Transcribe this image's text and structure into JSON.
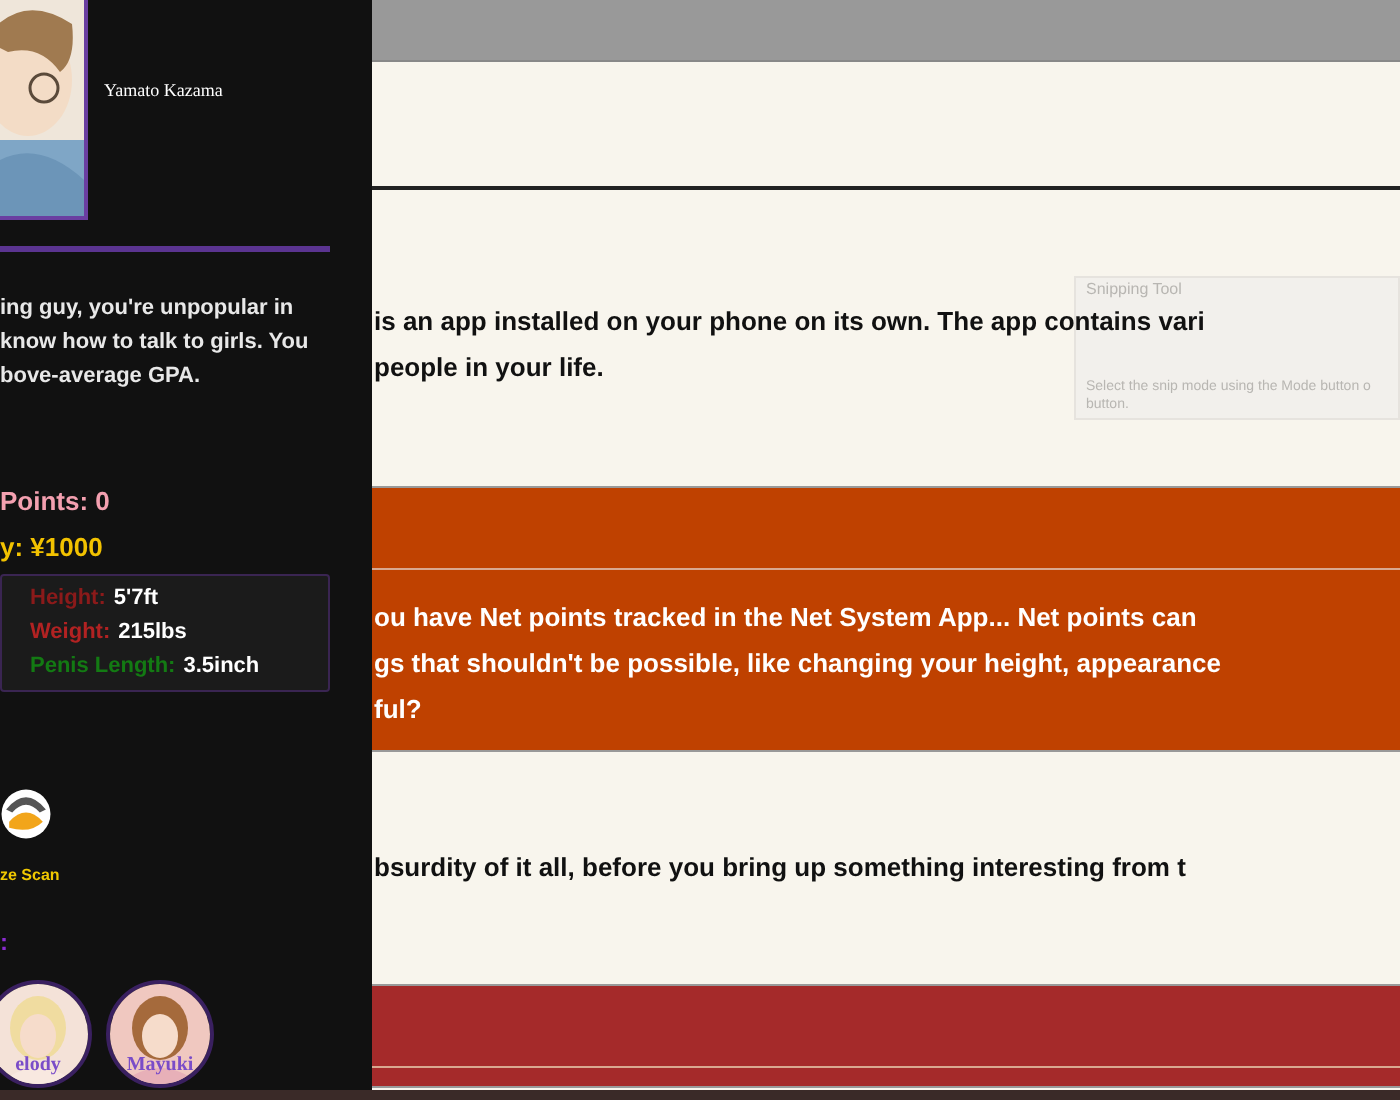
{
  "profile": {
    "name": "Yamato Kazama",
    "bio_lines": [
      "ing guy, you're unpopular in",
      "know how to talk to girls. You",
      "bove-average GPA."
    ],
    "points": "Points: 0",
    "money": "y: ¥1000"
  },
  "stats": [
    {
      "label": "Height:",
      "value": "5'7ft",
      "color": "#8b1a1a"
    },
    {
      "label": "Weight:",
      "value": "215lbs",
      "color": "#b22222"
    },
    {
      "label": "Penis Length:",
      "value": "3.5inch",
      "color": "#137a13"
    }
  ],
  "scan": {
    "label": "ze Scan"
  },
  "contacts_heading": ":",
  "contacts": [
    {
      "name": "elody"
    },
    {
      "name": "Mayuki"
    }
  ],
  "story": [
    {
      "kind": "plain",
      "lines": [
        "is an app installed on your phone on its own. The app contains vari",
        "people in your life."
      ]
    },
    {
      "kind": "banner",
      "color": "#bf4100",
      "lines": [
        "ou have Net points tracked in the Net System App... Net points can",
        "gs that shouldn't be possible, like changing your height, appearance",
        "ful?"
      ]
    },
    {
      "kind": "plain",
      "lines": [
        "bsurdity of it all, before you bring up something interesting from t"
      ]
    },
    {
      "kind": "banner",
      "color": "#a52a2a"
    }
  ],
  "overlay": {
    "title": "Snipping Tool",
    "hint_lines": [
      "Select the snip mode using the Mode button o",
      "button."
    ]
  }
}
